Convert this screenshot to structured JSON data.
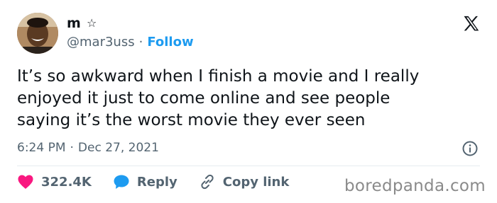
{
  "user": {
    "display_name": "m",
    "badge_icon": "star-icon",
    "handle": "@mar3uss",
    "separator": "·",
    "follow_label": "Follow"
  },
  "tweet": {
    "text": "It’s so awkward when I finish a movie and I really\nenjoyed it just to come online and see people\nsaying it’s the worst movie they ever seen",
    "time": "6:24 PM",
    "separator": "·",
    "date": "Dec 27, 2021"
  },
  "actions": {
    "likes_count": "322.4K",
    "reply_label": "Reply",
    "copy_link_label": "Copy link"
  },
  "watermark": "boredpanda.com",
  "colors": {
    "accent": "#1d9bf0",
    "like": "#f91880",
    "text": "#0f1419",
    "muted": "#536471"
  }
}
